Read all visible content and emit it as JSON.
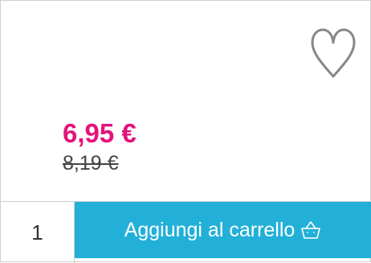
{
  "product": {
    "price_current": "6,95 €",
    "price_old": "8,19 €",
    "wishlist_icon": "heart-outline-icon"
  },
  "cart": {
    "quantity": "1",
    "add_button_label": "Aggiungi al carrello",
    "cart_icon": "basket-icon"
  },
  "colors": {
    "price": "#e2137a",
    "button": "#22b0d8"
  }
}
